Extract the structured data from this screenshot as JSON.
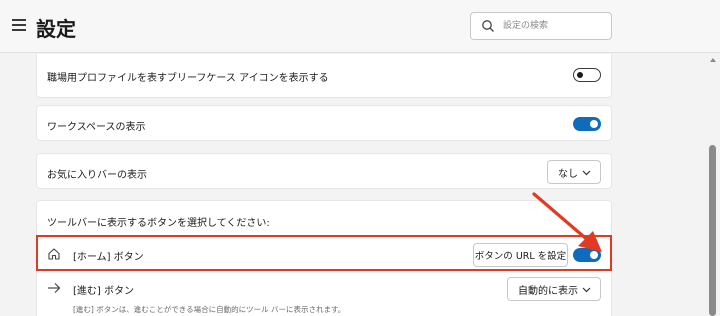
{
  "header": {
    "title": "設定",
    "search_placeholder": "設定の検索"
  },
  "rows": {
    "profile_icon": {
      "label": "職場用プロファイルを表すブリーフケース アイコンを表示する",
      "enabled": false
    },
    "workspace": {
      "label": "ワークスペースの表示",
      "enabled": true
    },
    "favorites_bar": {
      "label": "お気に入りバーの表示",
      "value": "なし"
    }
  },
  "toolbar_section": {
    "heading": "ツールバーに表示するボタンを選択してください:",
    "home": {
      "label": "[ホーム] ボタン",
      "set_url_label": "ボタンの URL を設定",
      "enabled": true
    },
    "forward": {
      "label": "[進む] ボタン",
      "value": "自動的に表示",
      "description": "[進む] ボタンは、進むことができる場合に自動的にツール バーに表示されます。"
    }
  },
  "colors": {
    "accent": "#0f6cbd",
    "highlight": "#e03a22"
  }
}
